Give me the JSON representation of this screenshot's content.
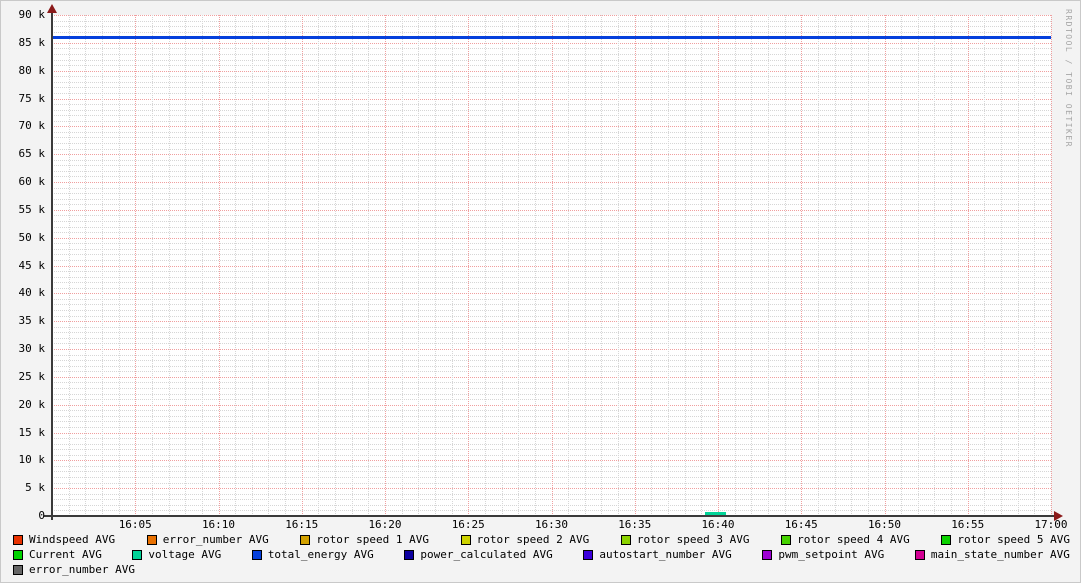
{
  "watermark": "RRDTOOL / TOBI OETIKER",
  "colors": {
    "background": "#f3f3f3",
    "plot_background": "#ffffff",
    "major_grid": "#f09f9f",
    "minor_grid": "#d6d6d6",
    "axis": "#3a3a3a",
    "arrow": "#8b1a1a"
  },
  "chart_data": {
    "type": "line",
    "title": "",
    "xlabel": "",
    "ylabel": "",
    "grid": true,
    "legend_position": "bottom",
    "x_axis": {
      "start_time": "16:00",
      "end_time": "17:00",
      "major_tick_minutes": 5,
      "minor_tick_minutes": 1,
      "tick_labels": [
        "16:05",
        "16:10",
        "16:15",
        "16:20",
        "16:25",
        "16:30",
        "16:35",
        "16:40",
        "16:45",
        "16:50",
        "16:55",
        "17:00"
      ]
    },
    "y_axis": {
      "min": 0,
      "max": 90000,
      "major_step": 5000,
      "minor_step": 1000,
      "tick_labels": [
        "0",
        "5 k",
        "10 k",
        "15 k",
        "20 k",
        "25 k",
        "30 k",
        "35 k",
        "40 k",
        "45 k",
        "50 k",
        "55 k",
        "60 k",
        "65 k",
        "70 k",
        "75 k",
        "80 k",
        "85 k",
        "90 k"
      ]
    },
    "series": [
      {
        "name": "total_energy AVG",
        "color": "#0540dc",
        "shape": "hline",
        "value": 86000,
        "x_start_minute": 0,
        "x_end_minute": 60,
        "thickness": 3
      },
      {
        "name": "voltage AVG",
        "color": "#00d397",
        "shape": "segment",
        "value": 500,
        "x_start_minute": 39.2,
        "x_end_minute": 40.5,
        "thickness": 3
      }
    ]
  },
  "legend": {
    "rows": [
      [
        {
          "label": "Windspeed AVG",
          "color": "#e83200"
        },
        {
          "label": "error_number AVG",
          "color": "#e87000"
        },
        {
          "label": "rotor speed 1 AVG",
          "color": "#d3a200"
        },
        {
          "label": "rotor speed 2 AVG",
          "color": "#ced300"
        },
        {
          "label": "rotor speed 3 AVG",
          "color": "#8cd300"
        },
        {
          "label": "rotor speed 4 AVG",
          "color": "#46d300"
        },
        {
          "label": "rotor speed 5 AVG",
          "color": "#0bd300"
        }
      ],
      [
        {
          "label": "Current AVG",
          "color": "#00d300"
        },
        {
          "label": "voltage AVG",
          "color": "#00d397"
        },
        {
          "label": "total_energy AVG",
          "color": "#0540dc"
        },
        {
          "label": "power_calculated AVG",
          "color": "#0d00a0"
        },
        {
          "label": "autostart_number AVG",
          "color": "#3c00dc"
        },
        {
          "label": "pwm_setpoint AVG",
          "color": "#9d00d3"
        },
        {
          "label": "main_state_number AVG",
          "color": "#d30093"
        }
      ],
      [
        {
          "label": "error_number AVG",
          "color": "#666666"
        }
      ]
    ]
  }
}
